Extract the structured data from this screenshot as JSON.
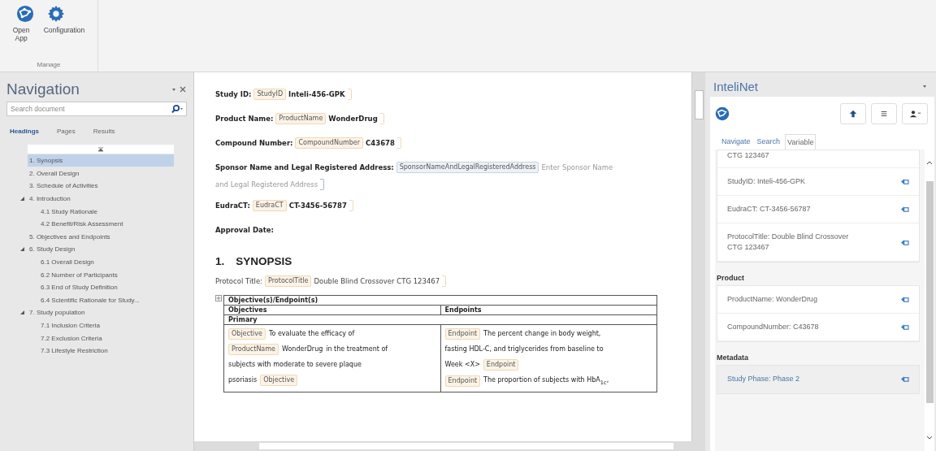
{
  "ribbon": {
    "groups": [
      {
        "label": "Manage",
        "buttons": [
          {
            "label": "Open\nApp",
            "kind": "globe"
          },
          {
            "label": "Configuration",
            "kind": "gear"
          }
        ]
      }
    ]
  },
  "navigation": {
    "title": "Navigation",
    "search": {
      "placeholder": "Search document"
    },
    "tabs": [
      {
        "label": "Headings",
        "selected": true
      },
      {
        "label": "Pages",
        "selected": false
      },
      {
        "label": "Results",
        "selected": false
      }
    ],
    "headings": [
      {
        "text": "1. Synopsis",
        "selected": true
      },
      {
        "text": "2. Overall Design",
        "selected": false
      },
      {
        "text": "3. Schedule of Activities",
        "selected": false
      },
      {
        "text": "4. Introduction",
        "selected": false,
        "expanded": true,
        "children": [
          {
            "text": "4.1 Study Rationale",
            "selected": false
          },
          {
            "text": "4.2 Benefit/Risk Assessment",
            "selected": false
          }
        ]
      },
      {
        "text": "5. Objectives and Endpoints",
        "selected": false
      },
      {
        "text": "6. Study Design",
        "selected": false,
        "expanded": true,
        "children": [
          {
            "text": "6.1 Overall Design",
            "selected": false
          },
          {
            "text": "6.2 Number of Participants",
            "selected": false
          },
          {
            "text": "6.3 End of Study Definition",
            "selected": false
          },
          {
            "text": "6.4 Scientific Rationale for Study...",
            "selected": false
          }
        ]
      },
      {
        "text": "7. Study population",
        "selected": false,
        "expanded": true,
        "children": [
          {
            "text": "7.1 Inclusion Criteria",
            "selected": false
          },
          {
            "text": "7.2 Exclusion Criteria",
            "selected": false
          },
          {
            "text": "7.3 Lifestyle Restriction",
            "selected": false
          }
        ]
      }
    ]
  },
  "document": {
    "fields": [
      {
        "label": "Study ID:",
        "tag": "StudyID",
        "value": "Inteli-456-GPK",
        "kind": "filled"
      },
      {
        "label": "Product Name:",
        "tag": "ProductName",
        "value": "WonderDrug",
        "kind": "filled"
      },
      {
        "label": "Compound Number:",
        "tag": "CompoundNumber",
        "value": "C43678",
        "kind": "filled"
      },
      {
        "label": "Sponsor Name and Legal Registered Address:",
        "tag": "SponsorNameAndLegalRegisteredAddress",
        "placeholder_lines": [
          "Enter Sponsor Name",
          "and Legal Registered Address"
        ],
        "kind": "placeholder"
      },
      {
        "label": "EudraCT:",
        "tag": "EudraCT",
        "value": "CT-3456-56787",
        "kind": "filled"
      },
      {
        "label": "Approval Date:",
        "kind": "empty"
      }
    ],
    "heading": {
      "number": "1.",
      "text": "SYNOPSIS"
    },
    "protocol": {
      "label": "Protocol Title:",
      "tag": "ProtocolTitle",
      "value": "Double Blind Crossover CTG 123467"
    },
    "table": {
      "title": "Objective(s)/Endpoint(s)",
      "columns": [
        "Objectives",
        "Endpoints"
      ],
      "section": "Primary",
      "cells": [
        [
          [
            {
              "kind": "tag",
              "text": "Objective"
            },
            {
              "kind": "text",
              "text": "To evaluate the efficacy of"
            }
          ],
          [
            {
              "kind": "tag",
              "text": "ProductName"
            },
            {
              "kind": "value",
              "text": "WonderDrug"
            },
            {
              "kind": "text",
              "text": "in the treatment of"
            }
          ],
          [
            {
              "kind": "text",
              "text": "subjects with moderate to severe plaque"
            }
          ],
          [
            {
              "kind": "text",
              "text": "psoriasis"
            },
            {
              "kind": "tag",
              "text": "Objective"
            }
          ]
        ],
        [
          [
            {
              "kind": "tag",
              "text": "Endpoint"
            },
            {
              "kind": "text",
              "text": "The percent change in body weight,"
            }
          ],
          [
            {
              "kind": "text",
              "text": "fasting HDL-C, and triglycerides from baseline to"
            }
          ],
          [
            {
              "kind": "text",
              "text": "Week <X>"
            },
            {
              "kind": "tag",
              "text": "Endpoint"
            }
          ],
          [
            {
              "kind": "tag",
              "text": "Endpoint"
            },
            {
              "kind": "text",
              "text": "The proportion of subjects with HbA$_{1c}$,"
            }
          ]
        ]
      ]
    }
  },
  "inteli": {
    "title": "InteliNet",
    "tabs": [
      {
        "label": "Navigate",
        "selected": false
      },
      {
        "label": "Search",
        "selected": false
      },
      {
        "label": "Variable",
        "selected": true
      }
    ],
    "sections": [
      {
        "items": [
          {
            "text": "CTG 123467",
            "kind": "partial",
            "selected": false
          },
          {
            "text": "StudyID: Inteli-456-GPK",
            "selected": false
          },
          {
            "text": "EudraCT: CT-3456-56787",
            "selected": false
          },
          {
            "text": "ProtocolTitle: Double Blind Crossover CTG 123467",
            "selected": false
          }
        ]
      },
      {
        "title": "Product",
        "items": [
          {
            "text": "ProductName: WonderDrug",
            "selected": false
          },
          {
            "text": "CompoundNumber: C43678",
            "selected": false
          }
        ]
      },
      {
        "title": "Metadata",
        "items": [
          {
            "text": "Study Phase: Phase 2",
            "selected": true
          }
        ]
      }
    ]
  }
}
